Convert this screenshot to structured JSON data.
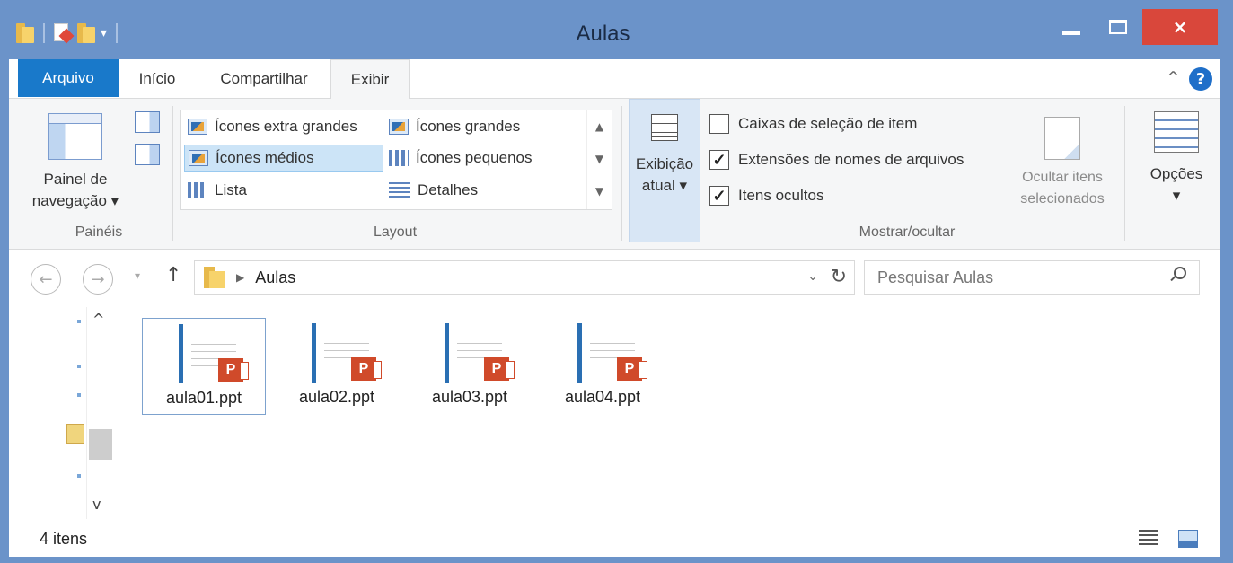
{
  "window": {
    "title": "Aulas",
    "close_symbol": "×"
  },
  "tabs": {
    "arquivo": "Arquivo",
    "inicio": "Início",
    "compartilhar": "Compartilhar",
    "exibir": "Exibir"
  },
  "ribbon": {
    "paineis": {
      "nav_pane_label_1": "Painel de",
      "nav_pane_label_2": "navegação",
      "group_label": "Painéis"
    },
    "layout": {
      "items": [
        "Ícones extra grandes",
        "Ícones grandes",
        "Ícones médios",
        "Ícones pequenos",
        "Lista",
        "Detalhes"
      ],
      "selected": "Ícones médios",
      "group_label": "Layout"
    },
    "current_view": {
      "label_1": "Exibição",
      "label_2": "atual"
    },
    "show_hide": {
      "checkboxes": [
        {
          "label": "Caixas de seleção de item",
          "checked": false
        },
        {
          "label": "Extensões de nomes de arquivos",
          "checked": true
        },
        {
          "label": "Itens ocultos",
          "checked": true
        }
      ],
      "hide_selected_1": "Ocultar itens",
      "hide_selected_2": "selecionados",
      "group_label": "Mostrar/ocultar"
    },
    "options": {
      "label": "Opções"
    }
  },
  "address_bar": {
    "path": "Aulas",
    "search_placeholder": "Pesquisar Aulas"
  },
  "files": [
    {
      "name": "aula01.ppt",
      "selected": true
    },
    {
      "name": "aula02.ppt",
      "selected": false
    },
    {
      "name": "aula03.ppt",
      "selected": false
    },
    {
      "name": "aula04.ppt",
      "selected": false
    }
  ],
  "status": {
    "item_count": "4 itens"
  },
  "colors": {
    "titlebar": "#6b93c9",
    "file_tab": "#1979ca",
    "close_button": "#d9473b",
    "selection": "#cce4f7"
  }
}
